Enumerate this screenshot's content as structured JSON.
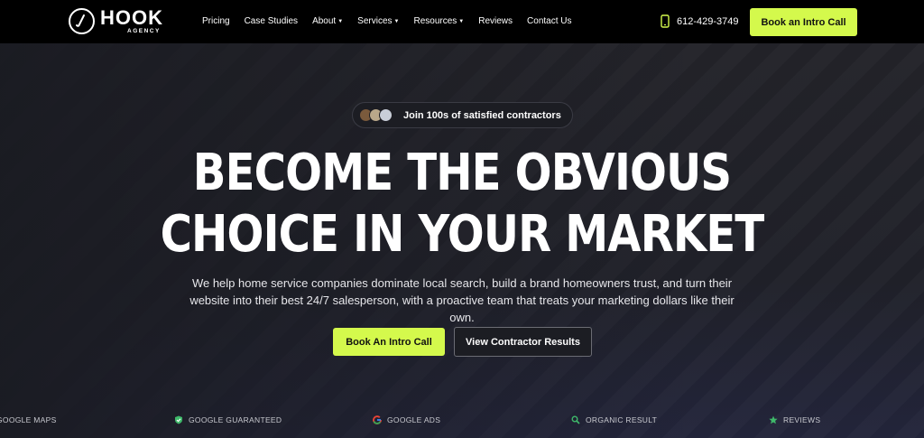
{
  "brand": {
    "name": "HOOK",
    "sub": "AGENCY"
  },
  "nav": {
    "items": [
      {
        "label": "Pricing",
        "dropdown": false
      },
      {
        "label": "Case Studies",
        "dropdown": false
      },
      {
        "label": "About",
        "dropdown": true
      },
      {
        "label": "Services",
        "dropdown": true
      },
      {
        "label": "Resources",
        "dropdown": true
      },
      {
        "label": "Reviews",
        "dropdown": false
      },
      {
        "label": "Contact Us",
        "dropdown": false
      }
    ],
    "phone": "612-429-3749",
    "phone_icon": "phone-icon",
    "cta": "Book an Intro Call"
  },
  "hero": {
    "pill_text": "Join 100s of satisfied contractors",
    "headline_line1": "BECOME THE OBVIOUS",
    "headline_line2": "CHOICE IN YOUR MARKET",
    "subtext": "We help home service companies dominate local search, build a brand homeowners trust, and turn their website into their best 24/7 salesperson, with a proactive team that treats your marketing dollars like their own.",
    "primary_button": "Book An Intro Call",
    "secondary_button": "View Contractor Results"
  },
  "ticker": {
    "items": [
      {
        "label": "GOOGLE MAPS",
        "icon": "map-pin-icon"
      },
      {
        "label": "GOOGLE GUARANTEED",
        "icon": "shield-check-icon"
      },
      {
        "label": "GOOGLE ADS",
        "icon": "google-g-icon"
      },
      {
        "label": "ORGANIC RESULT",
        "icon": "search-icon"
      },
      {
        "label": "REVIEWS",
        "icon": "star-icon"
      }
    ]
  },
  "colors": {
    "accent": "#d4f94c",
    "background": "#1a1b22",
    "nav": "#000000"
  }
}
